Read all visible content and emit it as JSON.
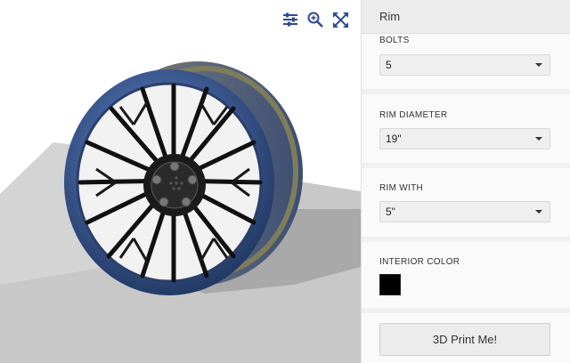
{
  "viewer": {
    "toolbar": {
      "settings_icon": "sliders-icon",
      "zoom_icon": "zoom-in-icon",
      "fullscreen_icon": "fullscreen-icon"
    },
    "accent_color": "#2f4a9c"
  },
  "panel": {
    "title": "Rim",
    "sections": {
      "bolts": {
        "label": "BOLTS",
        "value": "5"
      },
      "rim_diameter": {
        "label": "RIM DIAMETER",
        "value": "19\""
      },
      "rim_width": {
        "label": "RIM WITH",
        "value": "5\""
      },
      "interior_color": {
        "label": "INTERIOR COLOR",
        "value": "#000000"
      }
    },
    "print_button": "3D Print Me!"
  }
}
